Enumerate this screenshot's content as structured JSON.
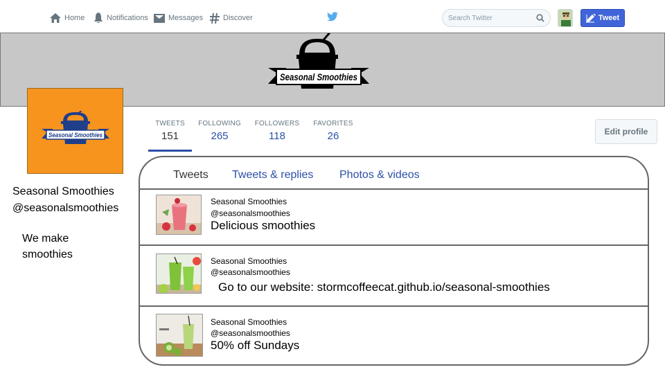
{
  "nav": {
    "home": "Home",
    "notifications": "Notifications",
    "messages": "Messages",
    "discover": "Discover",
    "search_placeholder": "Search Twitter",
    "tweet_button": "Tweet"
  },
  "profile": {
    "name": "Seasonal Smoothies",
    "handle": "@seasonalsmoothies",
    "bio": "We make smoothies",
    "logo_text": "Seasonal Smoothies",
    "edit_profile": "Edit profile"
  },
  "stats": [
    {
      "label": "TWEETS",
      "value": "151"
    },
    {
      "label": "FOLLOWING",
      "value": "265"
    },
    {
      "label": "FOLLOWERS",
      "value": "118"
    },
    {
      "label": "FAVORITES",
      "value": "26"
    }
  ],
  "tabs": [
    "Tweets",
    "Tweets & replies",
    "Photos & videos"
  ],
  "tweets": [
    {
      "name": "Seasonal Smoothies",
      "handle": "@seasonalsmoothies",
      "text": "Delicious smoothies"
    },
    {
      "name": "Seasonal Smoothies",
      "handle": "@seasonalsmoothies",
      "text": "Go to our website: stormcoffeecat.github.io/seasonal-smoothies"
    },
    {
      "name": "Seasonal Smoothies",
      "handle": "@seasonalsmoothies",
      "text": "50% off Sundays"
    }
  ],
  "colors": {
    "accent": "#2b4fa8",
    "tweet_button": "#4165d8",
    "avatar_bg": "#f7941d",
    "banner_bg": "#c7c7c7"
  }
}
